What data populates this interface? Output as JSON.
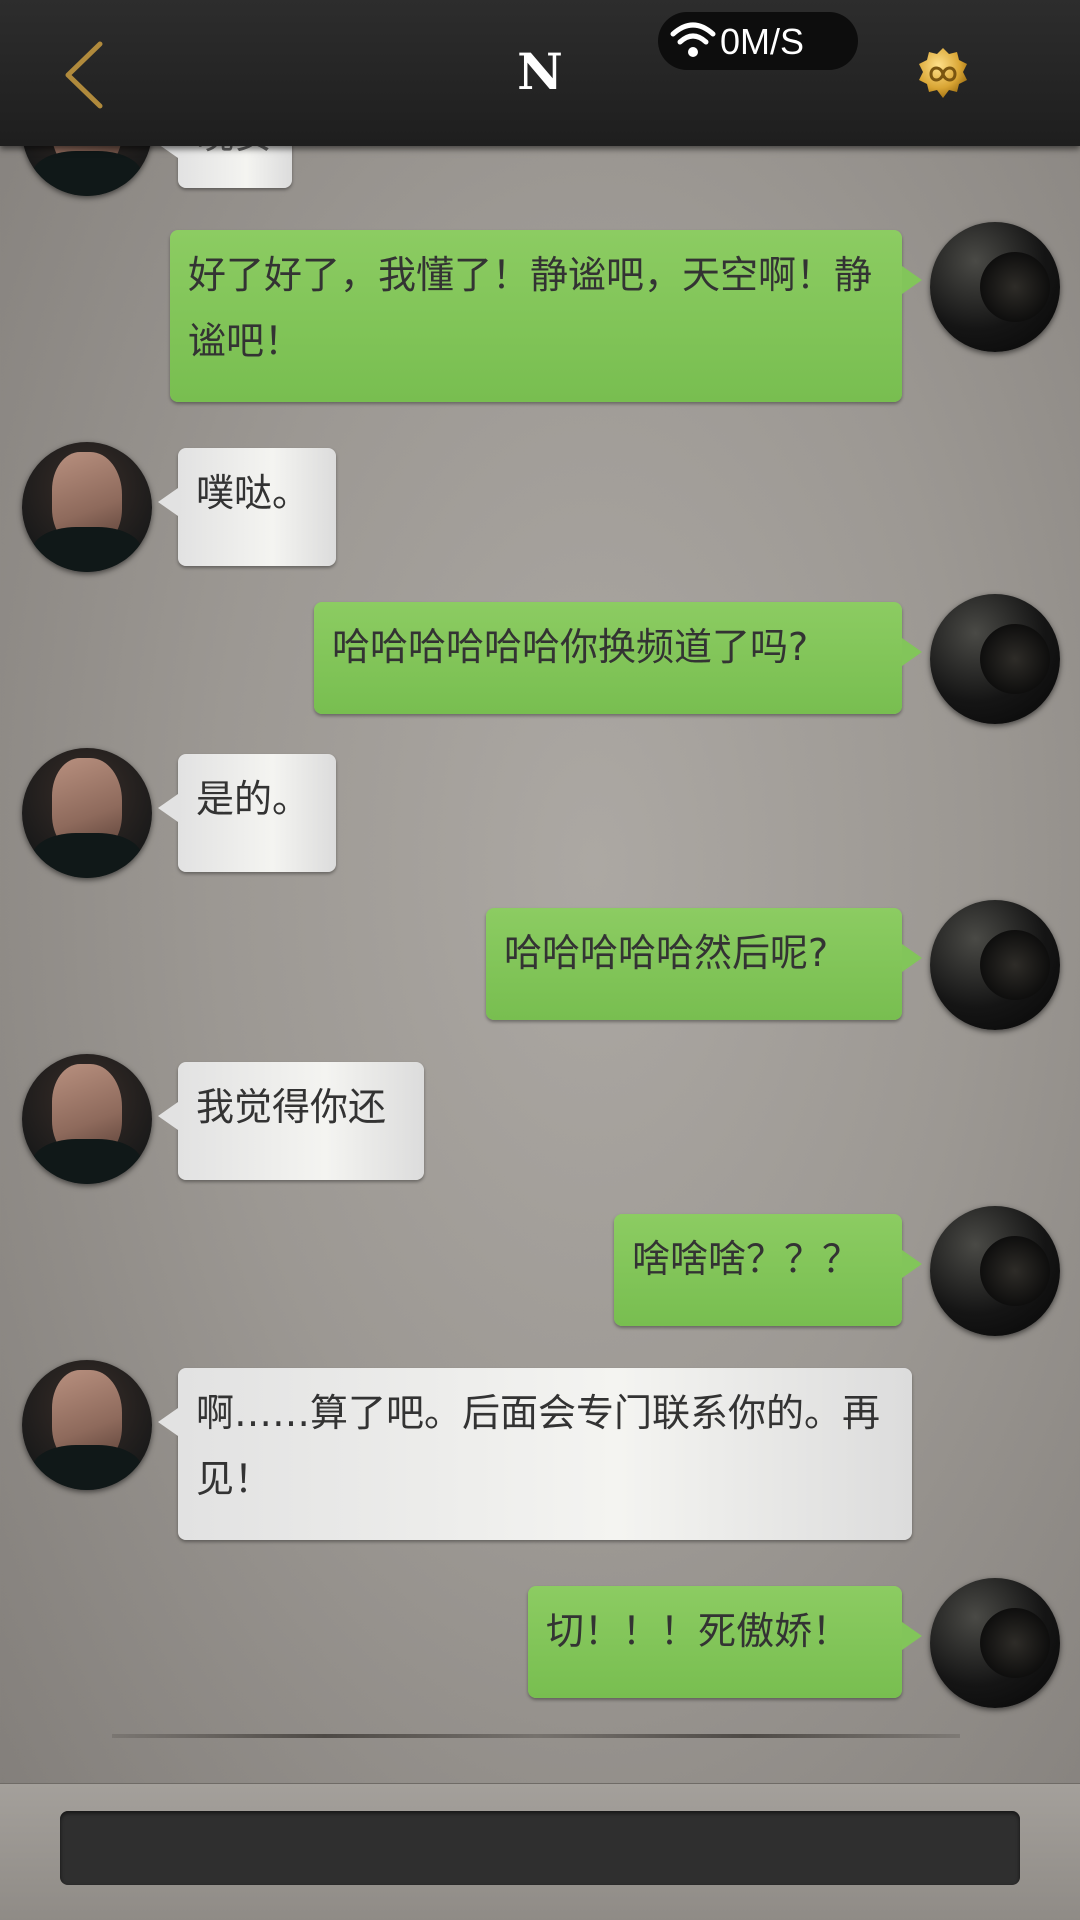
{
  "header": {
    "title": "N",
    "network_speed": "0M/S",
    "back_icon": "chevron-left-icon",
    "menu_icon": "infinity-coin-icon",
    "accent_color": "#c9a24a"
  },
  "chat": {
    "partial_top_bubble": "晚安",
    "messages": [
      {
        "side": "right",
        "text": "好了好了，我懂了！静谧吧，天空啊！静谧吧！"
      },
      {
        "side": "left",
        "text": "噗哒。"
      },
      {
        "side": "right",
        "text": "哈哈哈哈哈哈你换频道了吗?"
      },
      {
        "side": "left",
        "text": "是的。"
      },
      {
        "side": "right",
        "text": "哈哈哈哈哈然后呢?"
      },
      {
        "side": "left",
        "text": "我觉得你还"
      },
      {
        "side": "right",
        "text": "啥啥啥？？？"
      },
      {
        "side": "left",
        "text": "啊……算了吧。后面会专门联系你的。再见！"
      },
      {
        "side": "right",
        "text": "切！！！死傲娇！"
      }
    ],
    "bubble_colors": {
      "sent": "#80c457",
      "received": "#ececea"
    }
  },
  "input": {
    "value": "",
    "placeholder": ""
  }
}
